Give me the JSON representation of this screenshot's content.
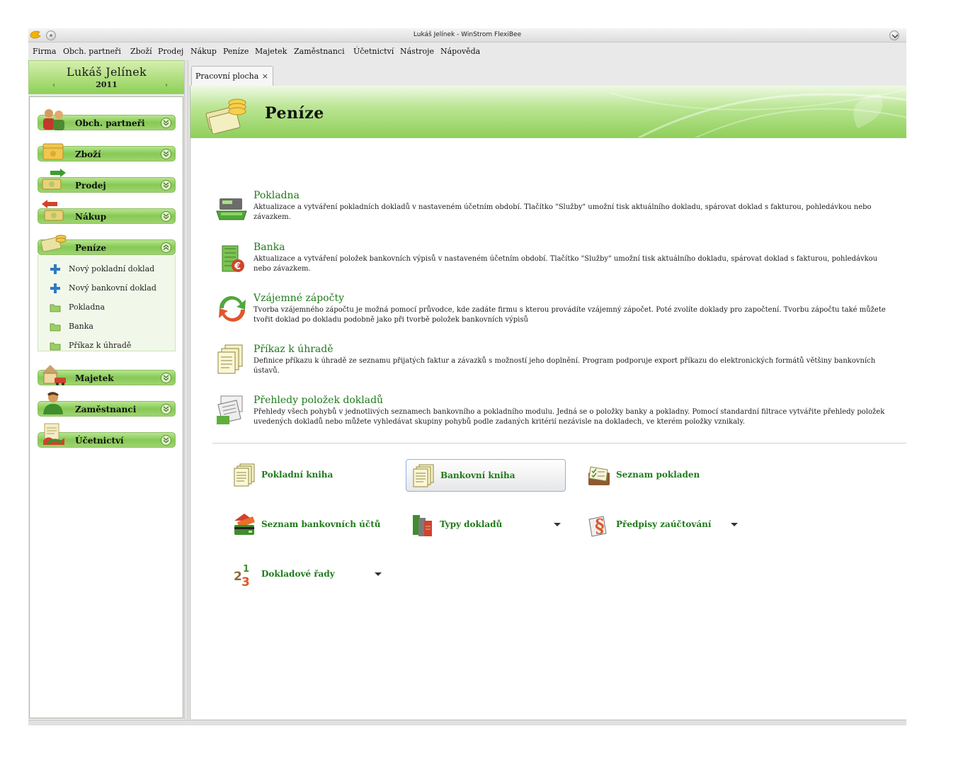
{
  "window": {
    "title": "Lukáš Jelínek - WinStrom FlexiBee"
  },
  "menu": [
    "Firma",
    "Obch. partneři",
    "Zboží",
    "Prodej",
    "Nákup",
    "Peníze",
    "Majetek",
    "Zaměstnanci",
    "Účetnictví",
    "Nástroje",
    "Nápověda"
  ],
  "user": {
    "name": "Lukáš Jelínek",
    "year": "2011",
    "prev": "‹",
    "next": "›"
  },
  "nav": {
    "groups": [
      {
        "label": "Obch. partneři",
        "icon": "partners-icon",
        "expanded": false
      },
      {
        "label": "Zboží",
        "icon": "goods-icon",
        "expanded": false
      },
      {
        "label": "Prodej",
        "icon": "sales-icon",
        "expanded": false
      },
      {
        "label": "Nákup",
        "icon": "purchase-icon",
        "expanded": false
      },
      {
        "label": "Peníze",
        "icon": "money-icon",
        "expanded": true
      },
      {
        "label": "Majetek",
        "icon": "property-icon",
        "expanded": false
      },
      {
        "label": "Zaměstnanci",
        "icon": "employee-icon",
        "expanded": false
      },
      {
        "label": "Účetnictví",
        "icon": "accounting-icon",
        "expanded": false
      }
    ],
    "penize_items": [
      {
        "label": "Nový pokladní doklad",
        "icon": "plus-icon"
      },
      {
        "label": "Nový bankovní doklad",
        "icon": "plus-icon"
      },
      {
        "label": "Pokladna",
        "icon": "folder-icon"
      },
      {
        "label": "Banka",
        "icon": "folder-icon"
      },
      {
        "label": "Příkaz k úhradě",
        "icon": "folder-icon"
      }
    ]
  },
  "tabs": [
    {
      "label": "Pracovní plocha",
      "close": "×"
    }
  ],
  "banner": {
    "title": "Peníze",
    "icon": "money-icon"
  },
  "features": [
    {
      "name": "Pokladna",
      "icon": "cash-register-icon",
      "desc": "Aktualizace a vytváření pokladních dokladů v nastaveném účetním období. Tlačítko \"Služby\" umožní tisk aktuálního dokladu, spárovat doklad s fakturou, pohledávkou nebo závazkem."
    },
    {
      "name": "Banka",
      "icon": "bank-icon",
      "desc": "Aktualizace a vytváření položek bankovních výpisů v nastaveném účetním období. Tlačítko \"Služby\" umožní tisk aktuálního dokladu, spárovat doklad s fakturou, pohledávkou nebo závazkem."
    },
    {
      "name": "Vzájemné zápočty",
      "icon": "offset-icon",
      "desc": "Tvorba vzájemného zápočtu je možná pomocí průvodce, kde zadáte firmu s kterou provádíte vzájemný zápočet. Poté zvolíte doklady pro započtení. Tvorbu zápočtu také můžete tvořit doklad po dokladu podobně jako při tvorbě položek bankovních výpisů"
    },
    {
      "name": "Příkaz k úhradě",
      "icon": "payment-order-icon",
      "desc": "Definice příkazu k úhradě ze seznamu přijatých faktur a závazků s možností jeho doplnění. Program podporuje export příkazu do elektronických formátů většiny bankovních ústavů."
    },
    {
      "name": "Přehledy položek dokladů",
      "icon": "document-items-icon",
      "desc": "Přehledy všech pohybů v jednotlivých seznamech bankovního a pokladního modulu. Jedná se o položky banky a pokladny. Pomocí standardní filtrace vytvářite přehledy položek uvedených dokladů nebo můžete vyhledávat skupiny pohybů podle zadaných kritérií nezávisle na dokladech, ve kterém položky vznikaly."
    }
  ],
  "quick": [
    {
      "label": "Pokladní kniha",
      "icon": "book-icon",
      "dropdown": false,
      "active": false
    },
    {
      "label": "Bankovní kniha",
      "icon": "book-icon",
      "dropdown": false,
      "active": true
    },
    {
      "label": "Seznam pokladen",
      "icon": "cash-list-icon",
      "dropdown": false,
      "active": false
    },
    {
      "label": "Seznam bankovních účtů",
      "icon": "bank-accounts-icon",
      "dropdown": false,
      "active": false
    },
    {
      "label": "Typy dokladů",
      "icon": "document-types-icon",
      "dropdown": true,
      "active": false
    },
    {
      "label": "Předpisy zaúčtování",
      "icon": "paragraph-icon",
      "dropdown": true,
      "active": false
    },
    {
      "label": "Dokladové řady",
      "icon": "numbering-icon",
      "dropdown": true,
      "active": false
    }
  ]
}
